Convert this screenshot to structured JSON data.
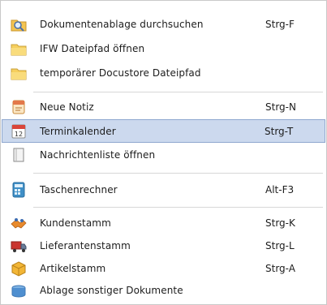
{
  "menu": {
    "items": [
      {
        "label": "Dokumentenablage durchsuchen",
        "shortcut": "Strg-F",
        "icon": "folder-search-icon"
      },
      {
        "label": "IFW Dateipfad öffnen",
        "shortcut": "",
        "icon": "folder-icon"
      },
      {
        "label": "temporärer Docustore Dateipfad",
        "shortcut": "",
        "icon": "folder-icon"
      },
      {
        "label": "Neue Notiz",
        "shortcut": "Strg-N",
        "icon": "note-icon"
      },
      {
        "label": "Terminkalender",
        "shortcut": "Strg-T",
        "icon": "calendar-icon",
        "selected": true
      },
      {
        "label": "Nachrichtenliste öffnen",
        "shortcut": "",
        "icon": "message-list-icon"
      },
      {
        "label": "Taschenrechner",
        "shortcut": "Alt-F3",
        "icon": "calculator-icon"
      },
      {
        "label": "Kundenstamm",
        "shortcut": "Strg-K",
        "icon": "customers-icon"
      },
      {
        "label": "Lieferantenstamm",
        "shortcut": "Strg-L",
        "icon": "supplier-truck-icon"
      },
      {
        "label": "Artikelstamm",
        "shortcut": "Strg-A",
        "icon": "articles-box-icon"
      },
      {
        "label": "Ablage sonstiger Dokumente",
        "shortcut": "",
        "icon": "documents-archive-icon"
      }
    ]
  },
  "colors": {
    "selection_bg": "#ccd9ee",
    "selection_border": "#8ea7cf",
    "separator": "#d7d7d7"
  }
}
